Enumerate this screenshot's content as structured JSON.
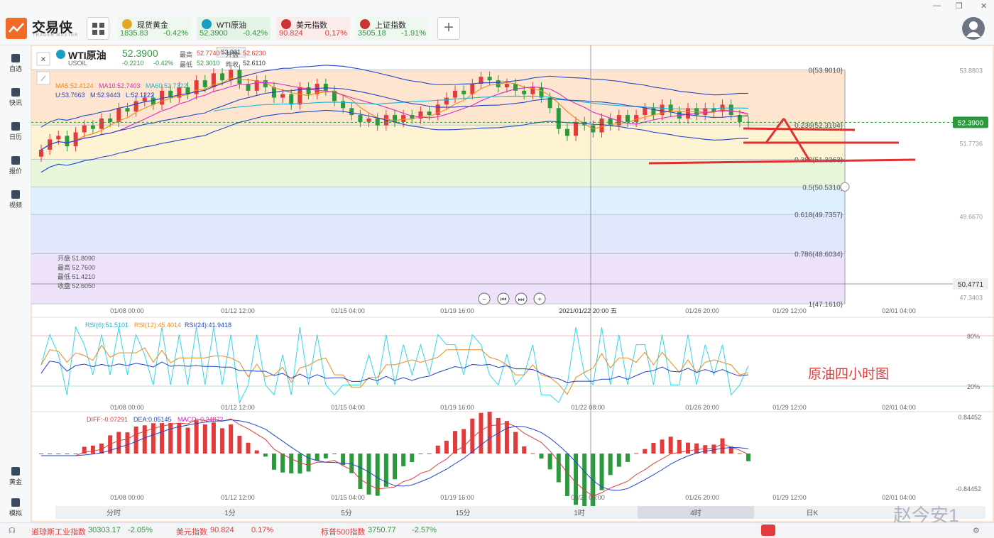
{
  "app": {
    "name": "交易侠",
    "subtitle": "TRADER MASTER",
    "window_controls": [
      "—",
      "❐",
      "✕"
    ]
  },
  "tabs": [
    {
      "name": "现货黄金",
      "price": "1835.83",
      "change": "-0.42%",
      "color": "#2a9a3c",
      "bg": "#eef8ee",
      "icon_color": "#e3a82b"
    },
    {
      "name": "WTI原油",
      "price": "52.3900",
      "change": "-0.42%",
      "color": "#2a9a3c",
      "bg": "#e4f4e6",
      "icon_color": "#1a9dc2"
    },
    {
      "name": "美元指数",
      "price": "90.824",
      "change": "0.17%",
      "color": "#e23b3b",
      "bg": "#fbeceb",
      "icon_color": "#c33"
    },
    {
      "name": "上证指数",
      "price": "3505.18",
      "change": "-1.91%",
      "color": "#2a9a3c",
      "bg": "#eef8ee",
      "icon_color": "#c33"
    }
  ],
  "sidebar": [
    {
      "label": "自选",
      "icon": "star-list-icon"
    },
    {
      "label": "快讯",
      "icon": "news-icon"
    },
    {
      "label": "日历",
      "icon": "calendar-icon"
    },
    {
      "label": "报价",
      "icon": "quote-icon"
    },
    {
      "label": "视频",
      "icon": "video-icon"
    },
    {
      "label": "黄金",
      "icon": "gold-icon"
    },
    {
      "label": "模拟",
      "icon": "wallet-icon"
    }
  ],
  "symbol": {
    "name": "WTI原油",
    "code": "USOIL",
    "price": "52.3900",
    "change": "-0.2210",
    "change_pct": "-0.42%",
    "high_label": "最高",
    "high": "52.7740",
    "open_label": "开盘",
    "open": "52.6230",
    "low_label": "最低",
    "low": "52.3010",
    "prev_label": "昨收",
    "prev": "52.6110"
  },
  "ma_text": {
    "ma5": "MA5:52.4124",
    "ma10": "MA10:52.7403",
    "ma60": "MA60:52.7322"
  },
  "boll_text": {
    "u": "U:53.7663",
    "m": "M:52.9443",
    "l": "L:52.1222"
  },
  "ohlc_box": [
    "开盘 51.8090",
    "最高 52.7600",
    "最低 51.4210",
    "收盘 52.6050"
  ],
  "fib": [
    {
      "label": "0(53.9010)",
      "v": 53.901
    },
    {
      "label": "0.236(52.3104)",
      "v": 52.31
    },
    {
      "label": "0.382(51.3263)",
      "v": 51.326
    },
    {
      "label": "0.5(50.5310)",
      "v": 50.531
    },
    {
      "label": "0.618(49.7357)",
      "v": 49.736
    },
    {
      "label": "0.786(48.6034)",
      "v": 48.603
    },
    {
      "label": "1(47.1610)",
      "v": 47.161
    }
  ],
  "right_axis": [
    "53.8803",
    "51.7736",
    "49.6670",
    "47.3403"
  ],
  "price_tag": "52.3900",
  "cursor_price": "50.4771",
  "peak_label": "53.901",
  "time_axis": [
    "01/08 00:00",
    "01/12 12:00",
    "01/15 04:00",
    "01/19 16:00",
    "2021/01/22 20:00 五",
    "01/26 20:00",
    "01/29 12:00",
    "02/01 04:00"
  ],
  "time_axis_sub": [
    "01/08 00:00",
    "01/12 12:00",
    "01/15 04:00",
    "01/19 16:00",
    "01/22 08:00",
    "01/26 20:00",
    "01/29 12:00",
    "02/01 04:00"
  ],
  "rsi": {
    "label6": "RSI(6):51.5101",
    "label12": "RSI(12):45.4014",
    "label24": "RSI(24):41.9418",
    "axis": [
      "80%",
      "20%"
    ]
  },
  "macd": {
    "diff": "DIFF:-0.07291",
    "dea": "DEA:0.05145",
    "macd": "MACD:-0.24872",
    "axis": [
      "0.84452",
      "-0.84452"
    ]
  },
  "periods": [
    "分时",
    "1分",
    "5分",
    "15分",
    "1时",
    "4时",
    "日K"
  ],
  "active_period": "4时",
  "annotation": "原油四小时图",
  "watermark": "赵今安1",
  "bottom": [
    {
      "name": "道琼斯工业指数",
      "price": "30303.17",
      "change": "-2.05%"
    },
    {
      "name": "美元指数",
      "price": "90.824",
      "change": "0.17%"
    },
    {
      "name": "标普500指数",
      "price": "3750.77",
      "change": "-2.57%"
    }
  ],
  "chart_data": {
    "type": "candlestick",
    "symbol": "WTI原油",
    "x_range": [
      "01/06",
      "02/02"
    ],
    "ylim": [
      47.0,
      54.4
    ],
    "closes": [
      51.6,
      51.9,
      52.0,
      51.7,
      52.1,
      52.3,
      52.2,
      52.5,
      52.4,
      52.8,
      52.7,
      53.0,
      53.1,
      52.9,
      53.3,
      53.1,
      53.4,
      53.2,
      53.6,
      53.4,
      53.8,
      53.6,
      53.9,
      53.5,
      53.3,
      53.6,
      53.4,
      53.1,
      53.2,
      52.9,
      53.4,
      53.2,
      53.5,
      53.3,
      53.0,
      52.8,
      52.6,
      52.4,
      52.5,
      52.3,
      52.6,
      52.4,
      52.6,
      52.5,
      52.7,
      52.6,
      52.9,
      53.1,
      53.3,
      53.2,
      53.5,
      53.7,
      53.6,
      53.4,
      53.5,
      53.3,
      53.2,
      53.4,
      53.1,
      52.8,
      52.2,
      52.0,
      52.4,
      52.3,
      52.1,
      52.5,
      52.3,
      52.6,
      52.4,
      52.6,
      52.8,
      52.6,
      52.9,
      52.7,
      52.5,
      52.8,
      52.6,
      52.8,
      52.7,
      52.9,
      52.6,
      52.4,
      52.39
    ]
  }
}
